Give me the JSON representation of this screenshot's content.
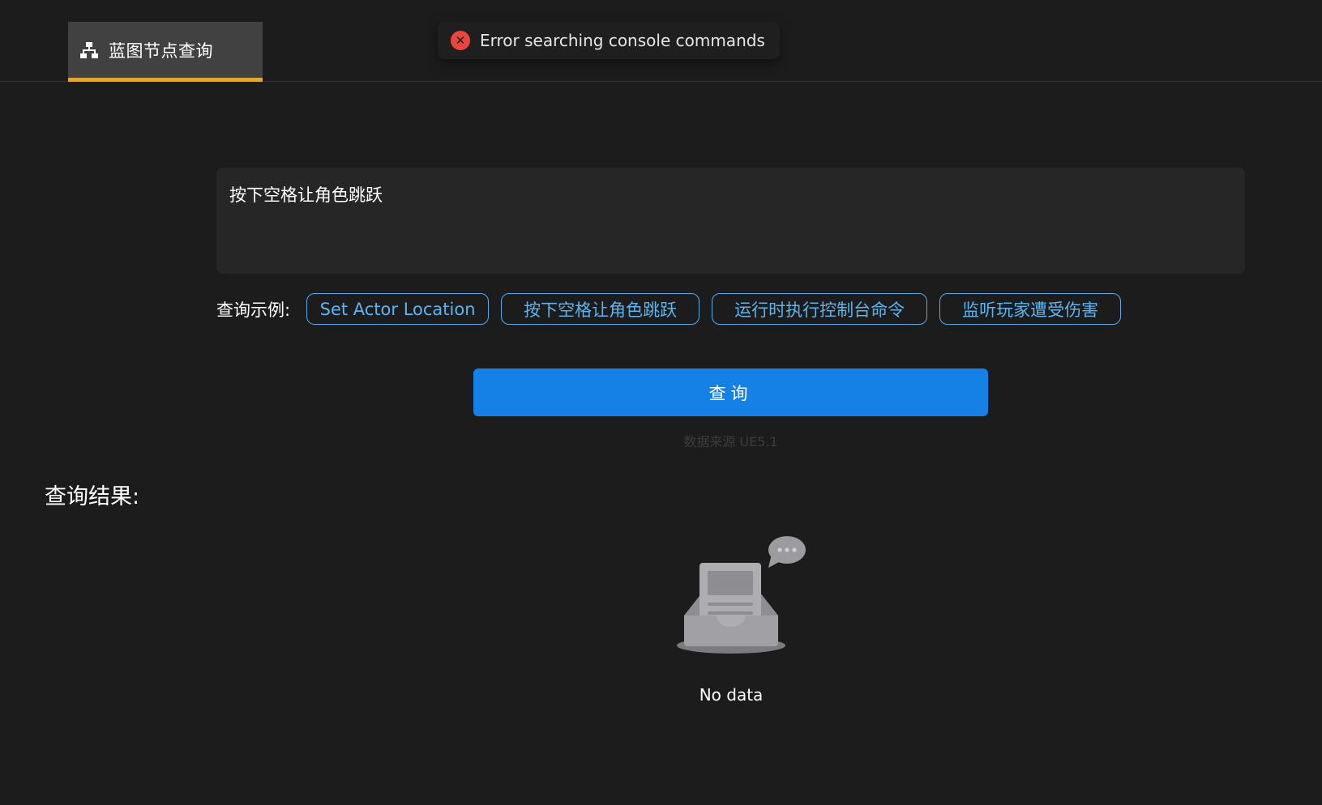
{
  "header": {
    "tab_label": "蓝图节点查询",
    "tab_icon": "hierarchy-icon",
    "accent_color": "#e0a92e"
  },
  "toast": {
    "icon": "error-circle-icon",
    "message": "Error searching console commands"
  },
  "query": {
    "value": "按下空格让角色跳跃"
  },
  "examples": {
    "label": "查询示例:",
    "items": [
      "Set Actor Location",
      "按下空格让角色跳跃",
      "运行时执行控制台命令",
      "监听玩家遭受伤害"
    ]
  },
  "search_button": {
    "label": "查询",
    "color": "#1581e6"
  },
  "source_note": "数据来源 UE5.1",
  "results": {
    "title": "查询结果:",
    "empty_icon": "empty-inbox-icon",
    "empty_text": "No data"
  }
}
